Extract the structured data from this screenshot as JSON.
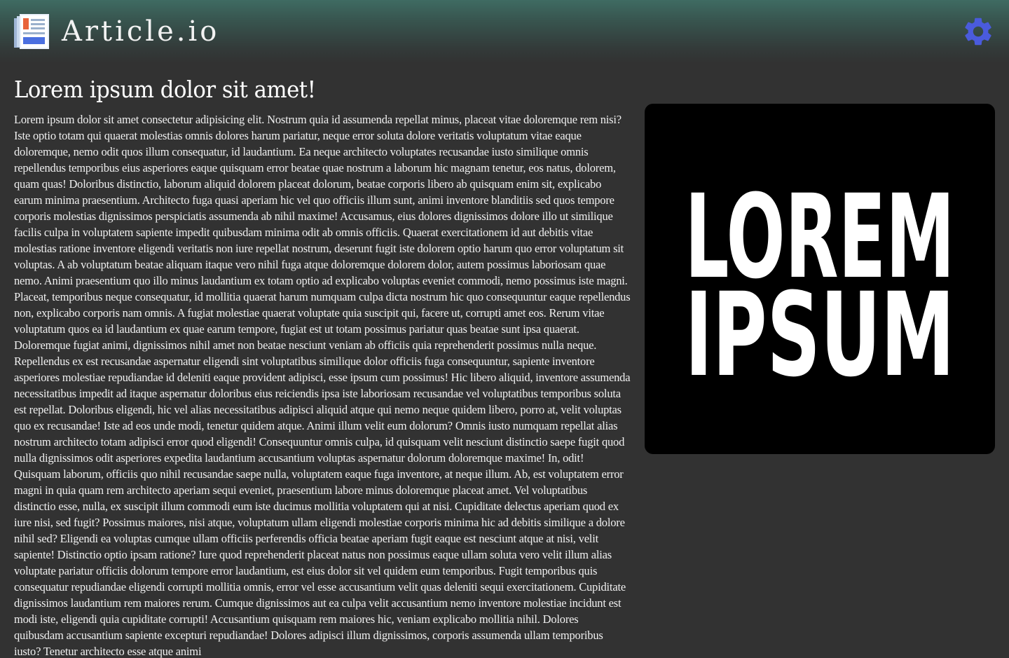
{
  "header": {
    "app_title": "Article.io",
    "logo_icon": "newspaper-icon",
    "settings_icon": "gear-icon",
    "accent_color": "#4a5bdc"
  },
  "article": {
    "title": "Lorem ipsum dolor sit amet!",
    "body": "Lorem ipsum dolor sit amet consectetur adipisicing elit. Nostrum quia id assumenda repellat minus, placeat vitae doloremque rem nisi? Iste optio totam qui quaerat molestias omnis dolores harum pariatur, neque error soluta dolore veritatis voluptatum vitae eaque doloremque, nemo odit quos illum consequatur, id laudantium. Ea neque architecto voluptates recusandae iusto similique omnis repellendus temporibus eius asperiores eaque quisquam error beatae quae nostrum a laborum hic magnam tenetur, eos natus, dolorem, quam quas! Doloribus distinctio, laborum aliquid dolorem placeat dolorum, beatae corporis libero ab quisquam enim sit, explicabo earum minima praesentium. Architecto fuga quasi aperiam hic vel quo officiis illum sunt, animi inventore blanditiis sed quos tempore corporis molestias dignissimos perspiciatis assumenda ab nihil maxime! Accusamus, eius dolores dignissimos dolore illo ut similique facilis culpa in voluptatem sapiente impedit quibusdam minima odit ab omnis officiis. Quaerat exercitationem id aut debitis vitae molestias ratione inventore eligendi veritatis non iure repellat nostrum, deserunt fugit iste dolorem optio harum quo error voluptatum sit voluptas. A ab voluptatum beatae aliquam itaque vero nihil fuga atque doloremque dolorem dolor, autem possimus laboriosam quae nemo. Animi praesentium quo illo minus laudantium ex totam optio ad explicabo voluptas eveniet commodi, nemo possimus iste magni. Placeat, temporibus neque consequatur, id mollitia quaerat harum numquam culpa dicta nostrum hic quo consequuntur eaque repellendus non, explicabo corporis nam omnis. A fugiat molestiae quaerat voluptate quia suscipit qui, facere ut, corrupti amet eos. Rerum vitae voluptatum quos ea id laudantium ex quae earum tempore, fugiat est ut totam possimus pariatur quas beatae sunt ipsa quaerat. Doloremque fugiat animi, dignissimos nihil amet non beatae nesciunt veniam ab officiis quia reprehenderit possimus nulla neque. Repellendus ex est recusandae aspernatur eligendi sint voluptatibus similique dolor officiis fuga consequuntur, sapiente inventore asperiores molestiae repudiandae id deleniti eaque provident adipisci, esse ipsum cum possimus! Hic libero aliquid, inventore assumenda necessitatibus impedit ad itaque aspernatur doloribus eius reiciendis ipsa iste laboriosam recusandae vel voluptatibus temporibus soluta est repellat. Doloribus eligendi, hic vel alias necessitatibus adipisci aliquid atque qui nemo neque quidem libero, porro at, velit voluptas quo ex recusandae! Iste ad eos unde modi, tenetur quidem atque. Animi illum velit eum dolorum? Omnis iusto numquam repellat alias nostrum architecto totam adipisci error quod eligendi! Consequuntur omnis culpa, id quisquam velit nesciunt distinctio saepe fugit quod nulla dignissimos odit asperiores expedita laudantium accusantium voluptas aspernatur dolorum doloremque maxime! In, odit! Quisquam laborum, officiis quo nihil recusandae saepe nulla, voluptatem eaque fuga inventore, at neque illum. Ab, est voluptatem error magni in quia quam rem architecto aperiam sequi eveniet, praesentium labore minus doloremque placeat amet. Vel voluptatibus distinctio esse, nulla, ex suscipit illum commodi eum iste ducimus mollitia voluptatem qui at nisi. Cupiditate delectus aperiam quod ex iure nisi, sed fugit? Possimus maiores, nisi atque, voluptatum ullam eligendi molestiae corporis minima hic ad debitis similique a dolore nihil sed? Eligendi ea voluptas cumque ullam officiis perferendis officia beatae aperiam fugit eaque est nesciunt atque at nisi, velit sapiente! Distinctio optio ipsam ratione? Iure quod reprehenderit placeat natus non possimus eaque ullam soluta vero velit illum alias voluptate pariatur officiis dolorum tempore error laudantium, est eius dolor sit vel quidem eum temporibus. Fugit temporibus quis consequatur repudiandae eligendi corrupti mollitia omnis, error vel esse accusantium velit quas deleniti sequi exercitationem. Cupiditate dignissimos laudantium rem maiores rerum. Cumque dignissimos aut ea culpa velit accusantium nemo inventore molestiae incidunt est modi iste, eligendi quia cupiditate corrupti! Accusantium quisquam rem maiores hic, veniam explicabo mollitia nihil. Dolores quibusdam accusantium sapiente excepturi repudiandae! Dolores adipisci illum dignissimos, corporis assumenda ullam temporibus iusto? Tenetur architecto esse atque animi"
  },
  "hero": {
    "line1": "LOREM",
    "line2": "IPSUM",
    "background": "#000000",
    "text_color": "#ffffff"
  }
}
